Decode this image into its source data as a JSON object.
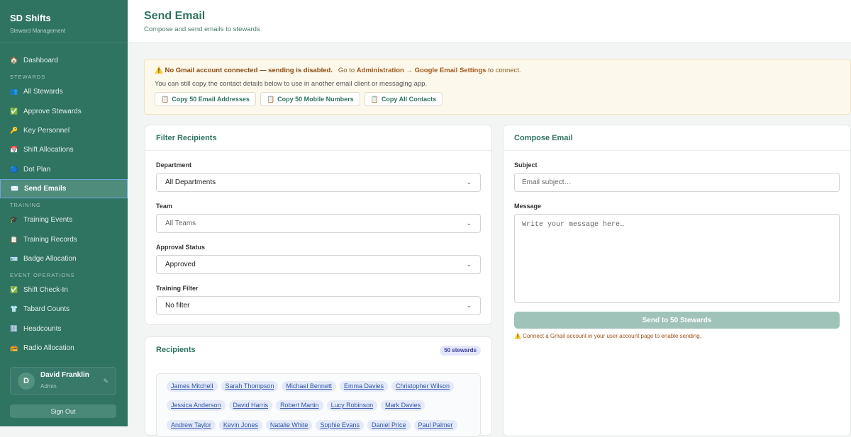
{
  "sidebar": {
    "title": "SD Shifts",
    "subtitle": "Steward Management",
    "dashboard": "Dashboard",
    "sections": [
      "STEWARDS",
      "TRAINING",
      "EVENT OPERATIONS"
    ],
    "stewards": [
      "All Stewards",
      "Approve Stewards",
      "Key Personnel",
      "Shift Allocations",
      "Dot Plan",
      "Send Emails"
    ],
    "training": [
      "Training Events",
      "Training Records",
      "Badge Allocation"
    ],
    "ops": [
      "Shift Check-In",
      "Tabard Counts",
      "Headcounts",
      "Radio Allocation"
    ],
    "user": {
      "initial": "D",
      "name": "David Franklin",
      "role": "Admin"
    },
    "signout": "Sign Out"
  },
  "header": {
    "title": "Send Email",
    "subtitle": "Compose and send emails to stewards"
  },
  "banner": {
    "warning": "No Gmail account connected — sending is disabled.",
    "goto": "Go to",
    "link": "Administration → Google Email Settings",
    "suffix": "to connect.",
    "info": "You can still copy the contact details below to use in another email client or messaging app.",
    "buttons": [
      "Copy 50 Email Addresses",
      "Copy 50 Mobile Numbers",
      "Copy All Contacts"
    ]
  },
  "filter": {
    "title": "Filter Recipients",
    "fields": [
      {
        "label": "Department",
        "value": "All Departments"
      },
      {
        "label": "Team",
        "value": "All Teams"
      },
      {
        "label": "Approval Status",
        "value": "Approved"
      },
      {
        "label": "Training Filter",
        "value": "No filter"
      }
    ]
  },
  "recipients": {
    "title": "Recipients",
    "count": "50 stewards",
    "names": [
      "James Mitchell",
      "Sarah Thompson",
      "Michael Bennett",
      "Emma Davies",
      "Christopher Wilson",
      "Jessica Anderson",
      "David Harris",
      "Robert Martin",
      "Lucy Robinson",
      "Mark Davies",
      "Andrew Taylor",
      "Kevin Jones",
      "Natalie White",
      "Sophie Evans",
      "Daniel Price",
      "Paul Palmer"
    ]
  },
  "compose": {
    "title": "Compose Email",
    "subject_label": "Subject",
    "subject_placeholder": "Email subject…",
    "message_label": "Message",
    "message_placeholder": "Write your message here…",
    "send": "Send to 50 Stewards",
    "warning": "Connect a Gmail account in your user account page to enable sending."
  }
}
